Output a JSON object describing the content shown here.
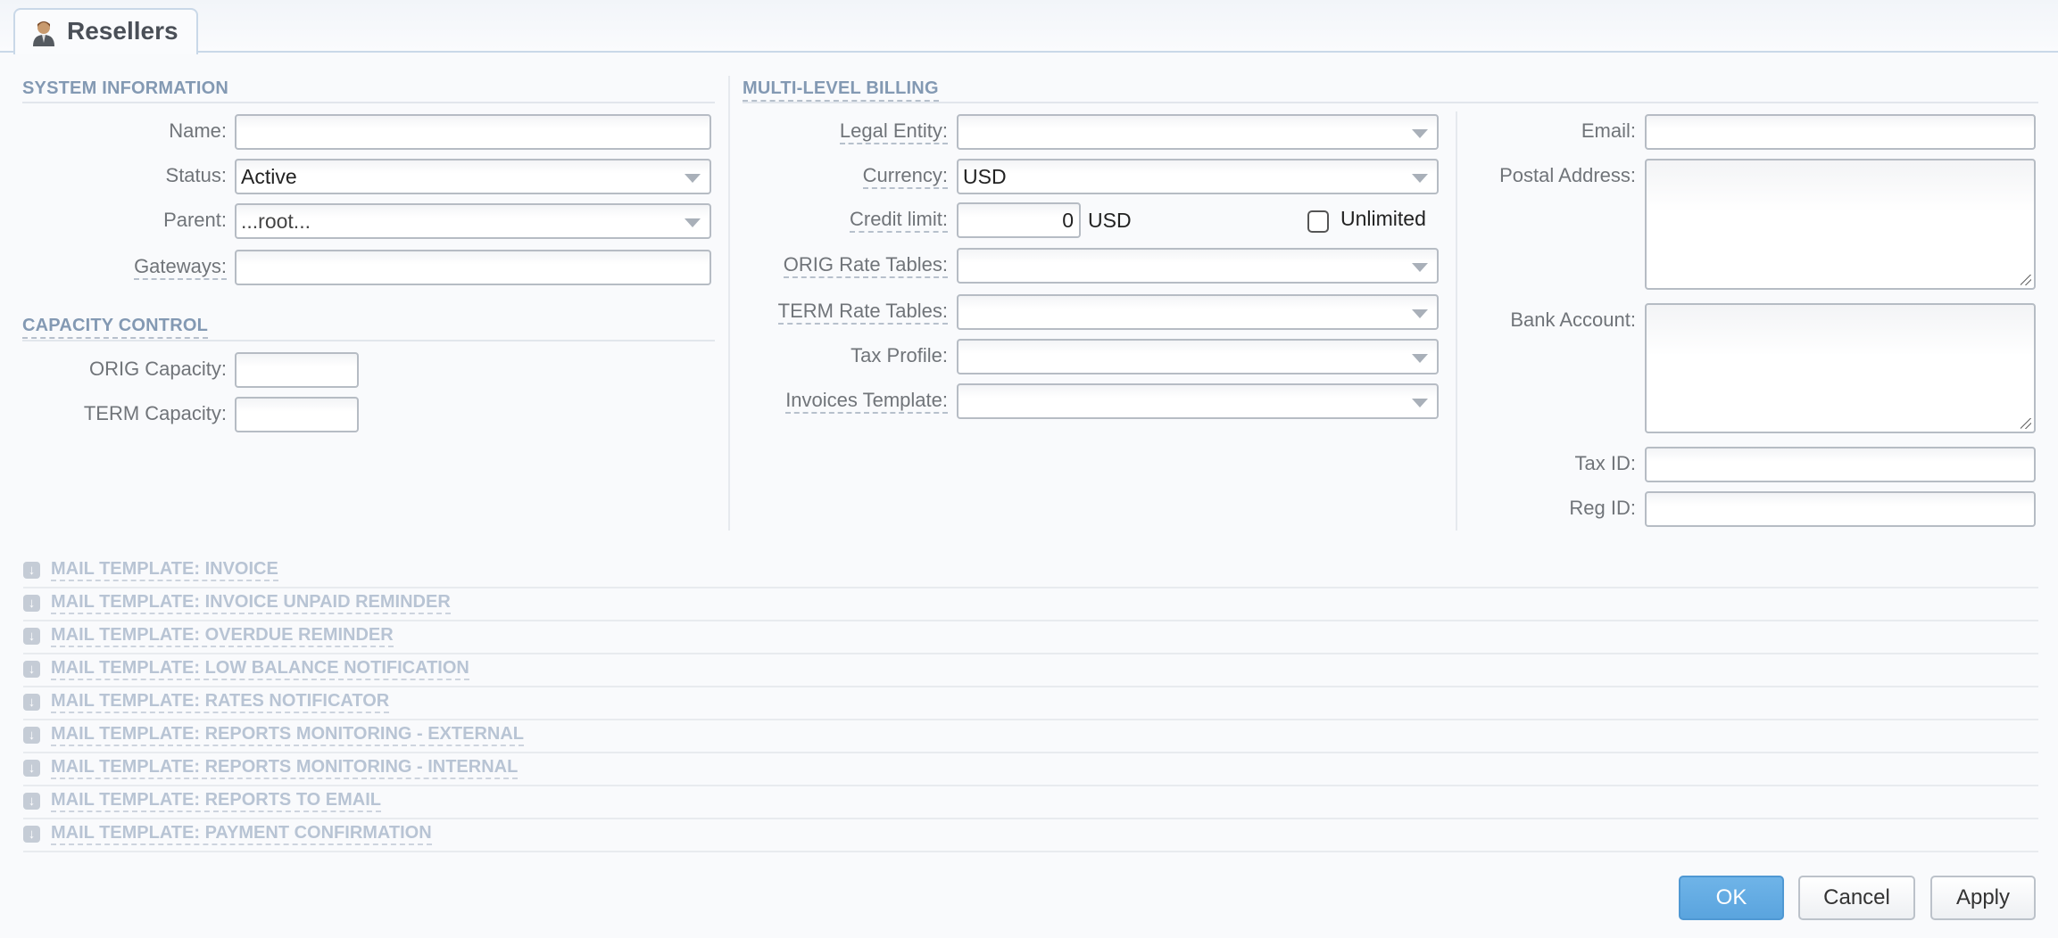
{
  "tab": {
    "title": "Resellers",
    "icon": "reseller-user-icon"
  },
  "system_information": {
    "heading": "SYSTEM INFORMATION",
    "name": {
      "label": "Name:",
      "value": ""
    },
    "status": {
      "label": "Status:",
      "value": "Active"
    },
    "parent": {
      "label": "Parent:",
      "value": "...root..."
    },
    "gateways": {
      "label": "Gateways:",
      "value": ""
    }
  },
  "capacity_control": {
    "heading": "CAPACITY CONTROL",
    "orig": {
      "label": "ORIG Capacity:",
      "value": ""
    },
    "term": {
      "label": "TERM Capacity:",
      "value": ""
    }
  },
  "billing": {
    "heading": "MULTI-LEVEL BILLING",
    "legal_entity": {
      "label": "Legal Entity:",
      "value": ""
    },
    "currency": {
      "label": "Currency:",
      "value": "USD"
    },
    "credit_limit": {
      "label": "Credit limit:",
      "value": "0",
      "unit": "USD",
      "unlimited_label": "Unlimited",
      "unlimited_checked": false
    },
    "orig_rate_tables": {
      "label": "ORIG Rate Tables:",
      "value": ""
    },
    "term_rate_tables": {
      "label": "TERM Rate Tables:",
      "value": ""
    },
    "tax_profile": {
      "label": "Tax Profile:",
      "value": ""
    },
    "invoices_template": {
      "label": "Invoices Template:",
      "value": ""
    }
  },
  "contact": {
    "email": {
      "label": "Email:",
      "value": ""
    },
    "postal_address": {
      "label": "Postal Address:",
      "value": ""
    },
    "bank_account": {
      "label": "Bank Account:",
      "value": ""
    },
    "tax_id": {
      "label": "Tax ID:",
      "value": ""
    },
    "reg_id": {
      "label": "Reg ID:",
      "value": ""
    }
  },
  "mail_templates": [
    "MAIL TEMPLATE: INVOICE",
    "MAIL TEMPLATE: INVOICE UNPAID REMINDER",
    "MAIL TEMPLATE: OVERDUE REMINDER",
    "MAIL TEMPLATE: LOW BALANCE NOTIFICATION",
    "MAIL TEMPLATE: RATES NOTIFICATOR",
    "MAIL TEMPLATE: REPORTS MONITORING - EXTERNAL",
    "MAIL TEMPLATE: REPORTS MONITORING - INTERNAL",
    "MAIL TEMPLATE: REPORTS TO EMAIL",
    "MAIL TEMPLATE: PAYMENT CONFIRMATION"
  ],
  "buttons": {
    "ok": "OK",
    "cancel": "Cancel",
    "apply": "Apply"
  },
  "colors": {
    "accent": "#5aa4de",
    "heading": "#8399b3",
    "collapsed_section": "#b8c4d4"
  }
}
